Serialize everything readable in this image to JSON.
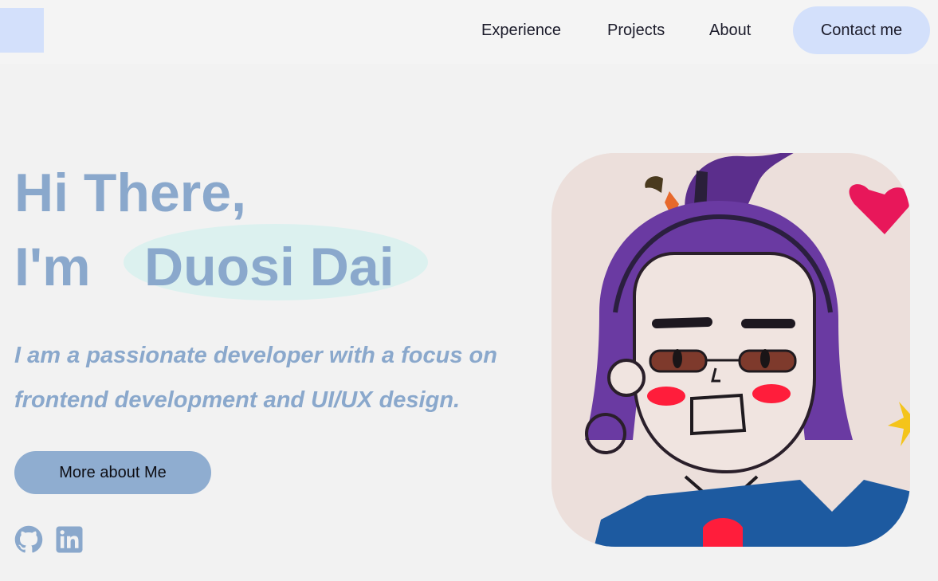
{
  "nav": {
    "experience": "Experience",
    "projects": "Projects",
    "about": "About",
    "contact": "Contact me"
  },
  "hero": {
    "line1": "Hi There,",
    "line2_prefix": "I'm",
    "name": "Duosi Dai",
    "tagline": "I am a passionate developer with a focus on frontend development and UI/UX design.",
    "more_button": "More about Me"
  },
  "social": {
    "icons": [
      "github-icon",
      "linkedin-icon"
    ]
  },
  "colors": {
    "accent": "#8aa8cc",
    "button_light": "#d3e0fb",
    "highlight": "#dcf1ef",
    "background": "#f2f2f2"
  }
}
